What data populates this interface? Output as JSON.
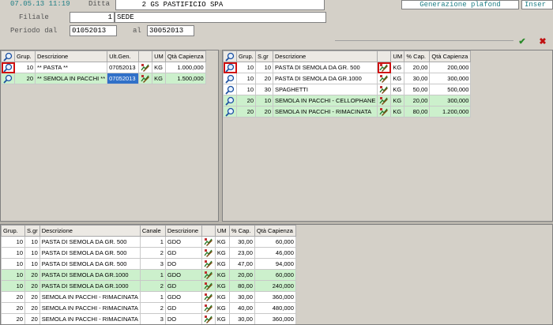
{
  "header": {
    "timestamp": "07.05.13 11:19",
    "ditta_label": "Ditta",
    "ditta_code": "2",
    "ditta_name": "GS PASTIFICIO SPA",
    "filiale_label": "Filiale",
    "filiale_code": "1",
    "filiale_name": "SEDE",
    "periodo_label": "Periodo dal",
    "periodo_from": "01052013",
    "al_label": "al",
    "periodo_to": "30052013",
    "tab_generazione": "Generazione  plafond",
    "tab_inser": "Inser",
    "confirm_icon": "check-icon",
    "cancel_icon": "x-icon"
  },
  "colors": {
    "accent": "#1f7f86",
    "row_green": "#ccf0cc",
    "selection": "#3070c8",
    "marker": "#d01010"
  },
  "left_grid": {
    "columns": [
      "Grup.",
      "Descrizione",
      "Ult.Gen.",
      "UM",
      "Qtà Capienza"
    ],
    "rows": [
      {
        "grup": "10",
        "descr": "** PASTA **",
        "ult_gen": "07052013",
        "um": "KG",
        "qta": "1.000,000",
        "green": false
      },
      {
        "grup": "20",
        "descr": "** SEMOLA IN PACCHI **",
        "ult_gen": "07052013",
        "um": "KG",
        "qta": "1.500,000",
        "green": true
      }
    ]
  },
  "right_grid": {
    "columns": [
      "Grup.",
      "S.gr",
      "Descrizione",
      "UM",
      "% Cap.",
      "Qtà Capienza"
    ],
    "rows": [
      {
        "grup": "10",
        "sgr": "10",
        "descr": "PASTA DI SEMOLA DA GR. 500",
        "um": "KG",
        "cap": "20,00",
        "qta": "200,000",
        "green": false
      },
      {
        "grup": "10",
        "sgr": "20",
        "descr": "PASTA DI SEMOLA DA GR.1000",
        "um": "KG",
        "cap": "30,00",
        "qta": "300,000",
        "green": false
      },
      {
        "grup": "10",
        "sgr": "30",
        "descr": "SPAGHETTI",
        "um": "KG",
        "cap": "50,00",
        "qta": "500,000",
        "green": false
      },
      {
        "grup": "20",
        "sgr": "10",
        "descr": "SEMOLA IN PACCHI - CELLOPHANE",
        "um": "KG",
        "cap": "20,00",
        "qta": "300,000",
        "green": true
      },
      {
        "grup": "20",
        "sgr": "20",
        "descr": "SEMOLA IN PACCHI - RIMACINATA",
        "um": "KG",
        "cap": "80,00",
        "qta": "1.200,000",
        "green": true
      }
    ]
  },
  "bottom_grid": {
    "columns": [
      "Grup.",
      "S.gr",
      "Descrizione",
      "Canale",
      "Descrizione",
      "UM",
      "% Cap.",
      "Qtà Capienza"
    ],
    "rows": [
      {
        "grup": "10",
        "sgr": "10",
        "descr": "PASTA DI SEMOLA DA GR. 500",
        "canale": "1",
        "cdescr": "GDO",
        "um": "KG",
        "cap": "30,00",
        "qta": "60,000",
        "green": false
      },
      {
        "grup": "10",
        "sgr": "10",
        "descr": "PASTA DI SEMOLA DA GR. 500",
        "canale": "2",
        "cdescr": "GD",
        "um": "KG",
        "cap": "23,00",
        "qta": "46,000",
        "green": false
      },
      {
        "grup": "10",
        "sgr": "10",
        "descr": "PASTA DI SEMOLA DA GR. 500",
        "canale": "3",
        "cdescr": "DO",
        "um": "KG",
        "cap": "47,00",
        "qta": "94,000",
        "green": false
      },
      {
        "grup": "10",
        "sgr": "20",
        "descr": "PASTA DI SEMOLA DA GR.1000",
        "canale": "1",
        "cdescr": "GDO",
        "um": "KG",
        "cap": "20,00",
        "qta": "60,000",
        "green": true
      },
      {
        "grup": "10",
        "sgr": "20",
        "descr": "PASTA DI SEMOLA DA GR.1000",
        "canale": "2",
        "cdescr": "GD",
        "um": "KG",
        "cap": "80,00",
        "qta": "240,000",
        "green": true
      },
      {
        "grup": "20",
        "sgr": "20",
        "descr": "SEMOLA IN PACCHI - RIMACINATA",
        "canale": "1",
        "cdescr": "GDO",
        "um": "KG",
        "cap": "30,00",
        "qta": "360,000",
        "green": false
      },
      {
        "grup": "20",
        "sgr": "20",
        "descr": "SEMOLA IN PACCHI - RIMACINATA",
        "canale": "2",
        "cdescr": "GD",
        "um": "KG",
        "cap": "40,00",
        "qta": "480,000",
        "green": false
      },
      {
        "grup": "20",
        "sgr": "20",
        "descr": "SEMOLA IN PACCHI - RIMACINATA",
        "canale": "3",
        "cdescr": "DO",
        "um": "KG",
        "cap": "30,00",
        "qta": "360,000",
        "green": false
      }
    ]
  }
}
